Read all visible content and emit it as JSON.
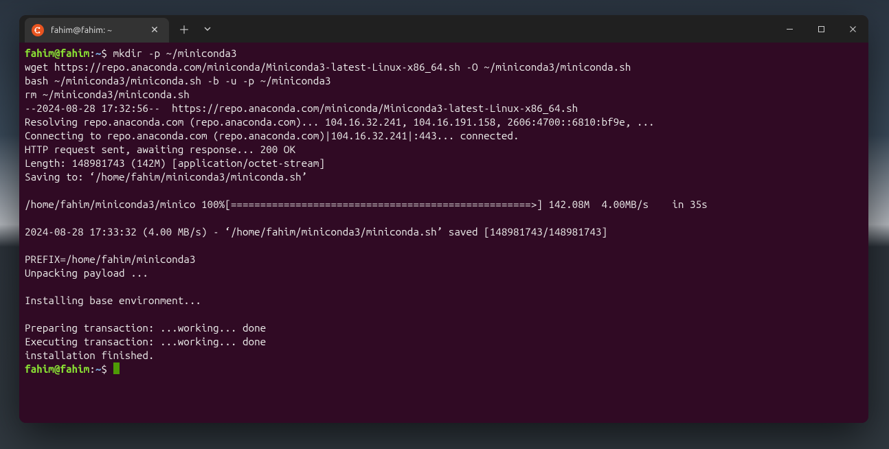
{
  "window": {
    "tab_title": "fahim@fahim: ~",
    "icon_name": "ubuntu-logo"
  },
  "prompt": {
    "user_host": "fahim@fahim",
    "separator": ":",
    "path": "~",
    "symbol": "$"
  },
  "lines": {
    "cmd1": " mkdir -p ~/miniconda3",
    "l2": "wget https://repo.anaconda.com/miniconda/Miniconda3-latest-Linux-x86_64.sh -O ~/miniconda3/miniconda.sh",
    "l3": "bash ~/miniconda3/miniconda.sh -b -u -p ~/miniconda3",
    "l4": "rm ~/miniconda3/miniconda.sh",
    "l5": "--2024-08-28 17:32:56--  https://repo.anaconda.com/miniconda/Miniconda3-latest-Linux-x86_64.sh",
    "l6": "Resolving repo.anaconda.com (repo.anaconda.com)... 104.16.32.241, 104.16.191.158, 2606:4700::6810:bf9e, ...",
    "l7": "Connecting to repo.anaconda.com (repo.anaconda.com)|104.16.32.241|:443... connected.",
    "l8": "HTTP request sent, awaiting response... 200 OK",
    "l9": "Length: 148981743 (142M) [application/octet-stream]",
    "l10": "Saving to: ‘/home/fahim/miniconda3/miniconda.sh’",
    "l11": "",
    "l12": "/home/fahim/miniconda3/minico 100%[===================================================>] 142.08M  4.00MB/s    in 35s",
    "l13": "",
    "l14": "2024-08-28 17:33:32 (4.00 MB/s) - ‘/home/fahim/miniconda3/miniconda.sh’ saved [148981743/148981743]",
    "l15": "",
    "l16": "PREFIX=/home/fahim/miniconda3",
    "l17": "Unpacking payload ...",
    "l18": "",
    "l19": "Installing base environment...",
    "l20": "",
    "l21": "Preparing transaction: ...working... done",
    "l22": "Executing transaction: ...working... done",
    "l23": "installation finished."
  }
}
